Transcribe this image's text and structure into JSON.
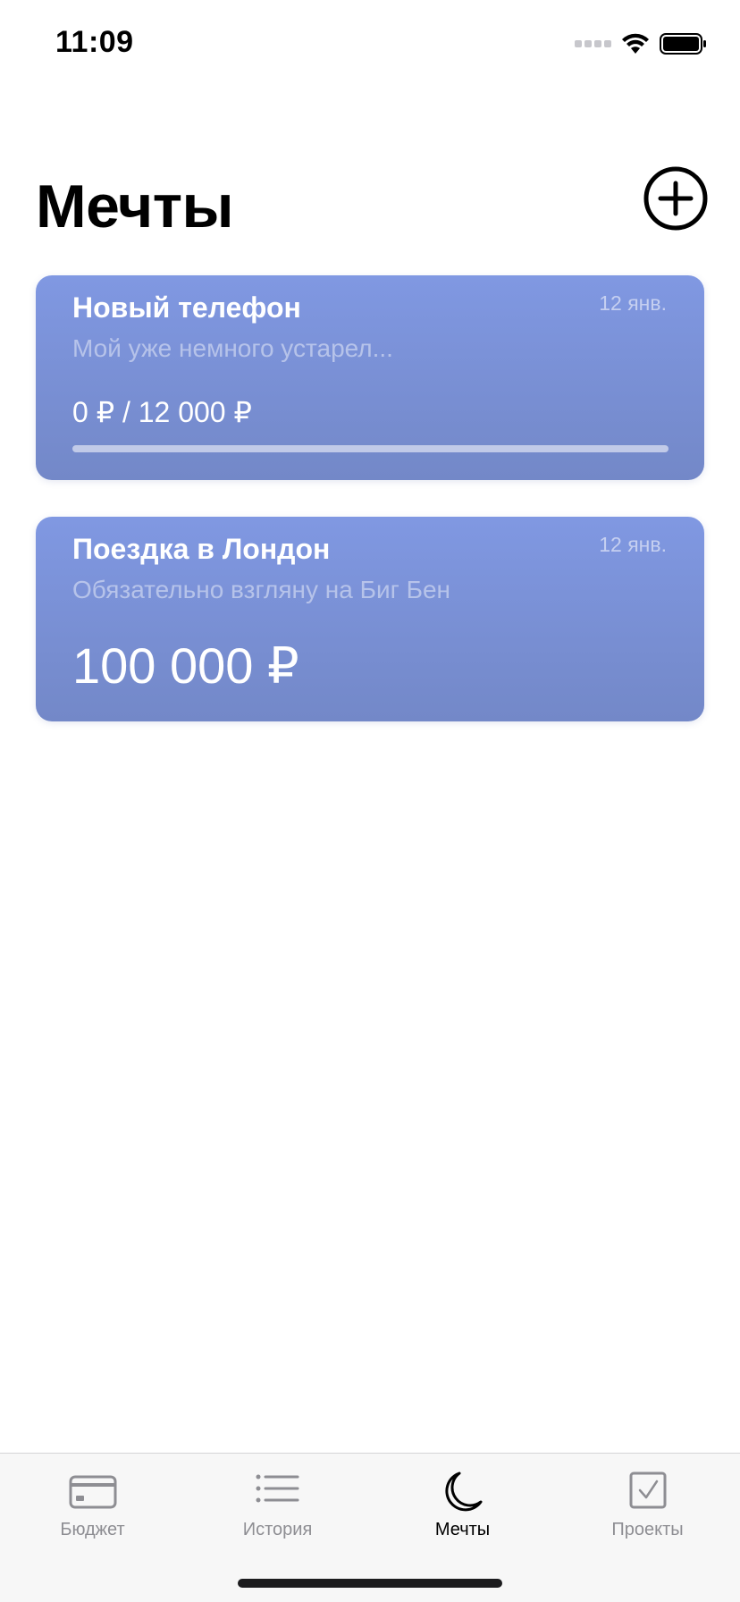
{
  "status_bar": {
    "time": "11:09"
  },
  "header": {
    "title": "Мечты",
    "add_icon": "plus-circle-icon"
  },
  "dreams": [
    {
      "title": "Новый телефон",
      "date": "12 янв.",
      "description": "Мой уже немного устарел...",
      "amount_text": "0 ₽ / 12 000 ₽",
      "progress": 0
    },
    {
      "title": "Поездка в Лондон",
      "date": "12 янв.",
      "description": "Обязательно взгляну на Биг Бен",
      "amount_text": "100 000 ₽"
    }
  ],
  "tab_bar": {
    "tabs": [
      {
        "label": "Бюджет",
        "icon": "credit-card-icon",
        "active": false
      },
      {
        "label": "История",
        "icon": "list-icon",
        "active": false
      },
      {
        "label": "Мечты",
        "icon": "moon-icon",
        "active": true
      },
      {
        "label": "Проекты",
        "icon": "checkbox-icon",
        "active": false
      }
    ]
  },
  "colors": {
    "card_top": "#8098e2",
    "card_bottom": "#7388c8",
    "tab_inactive": "#8e8e93",
    "tab_active": "#000000"
  }
}
